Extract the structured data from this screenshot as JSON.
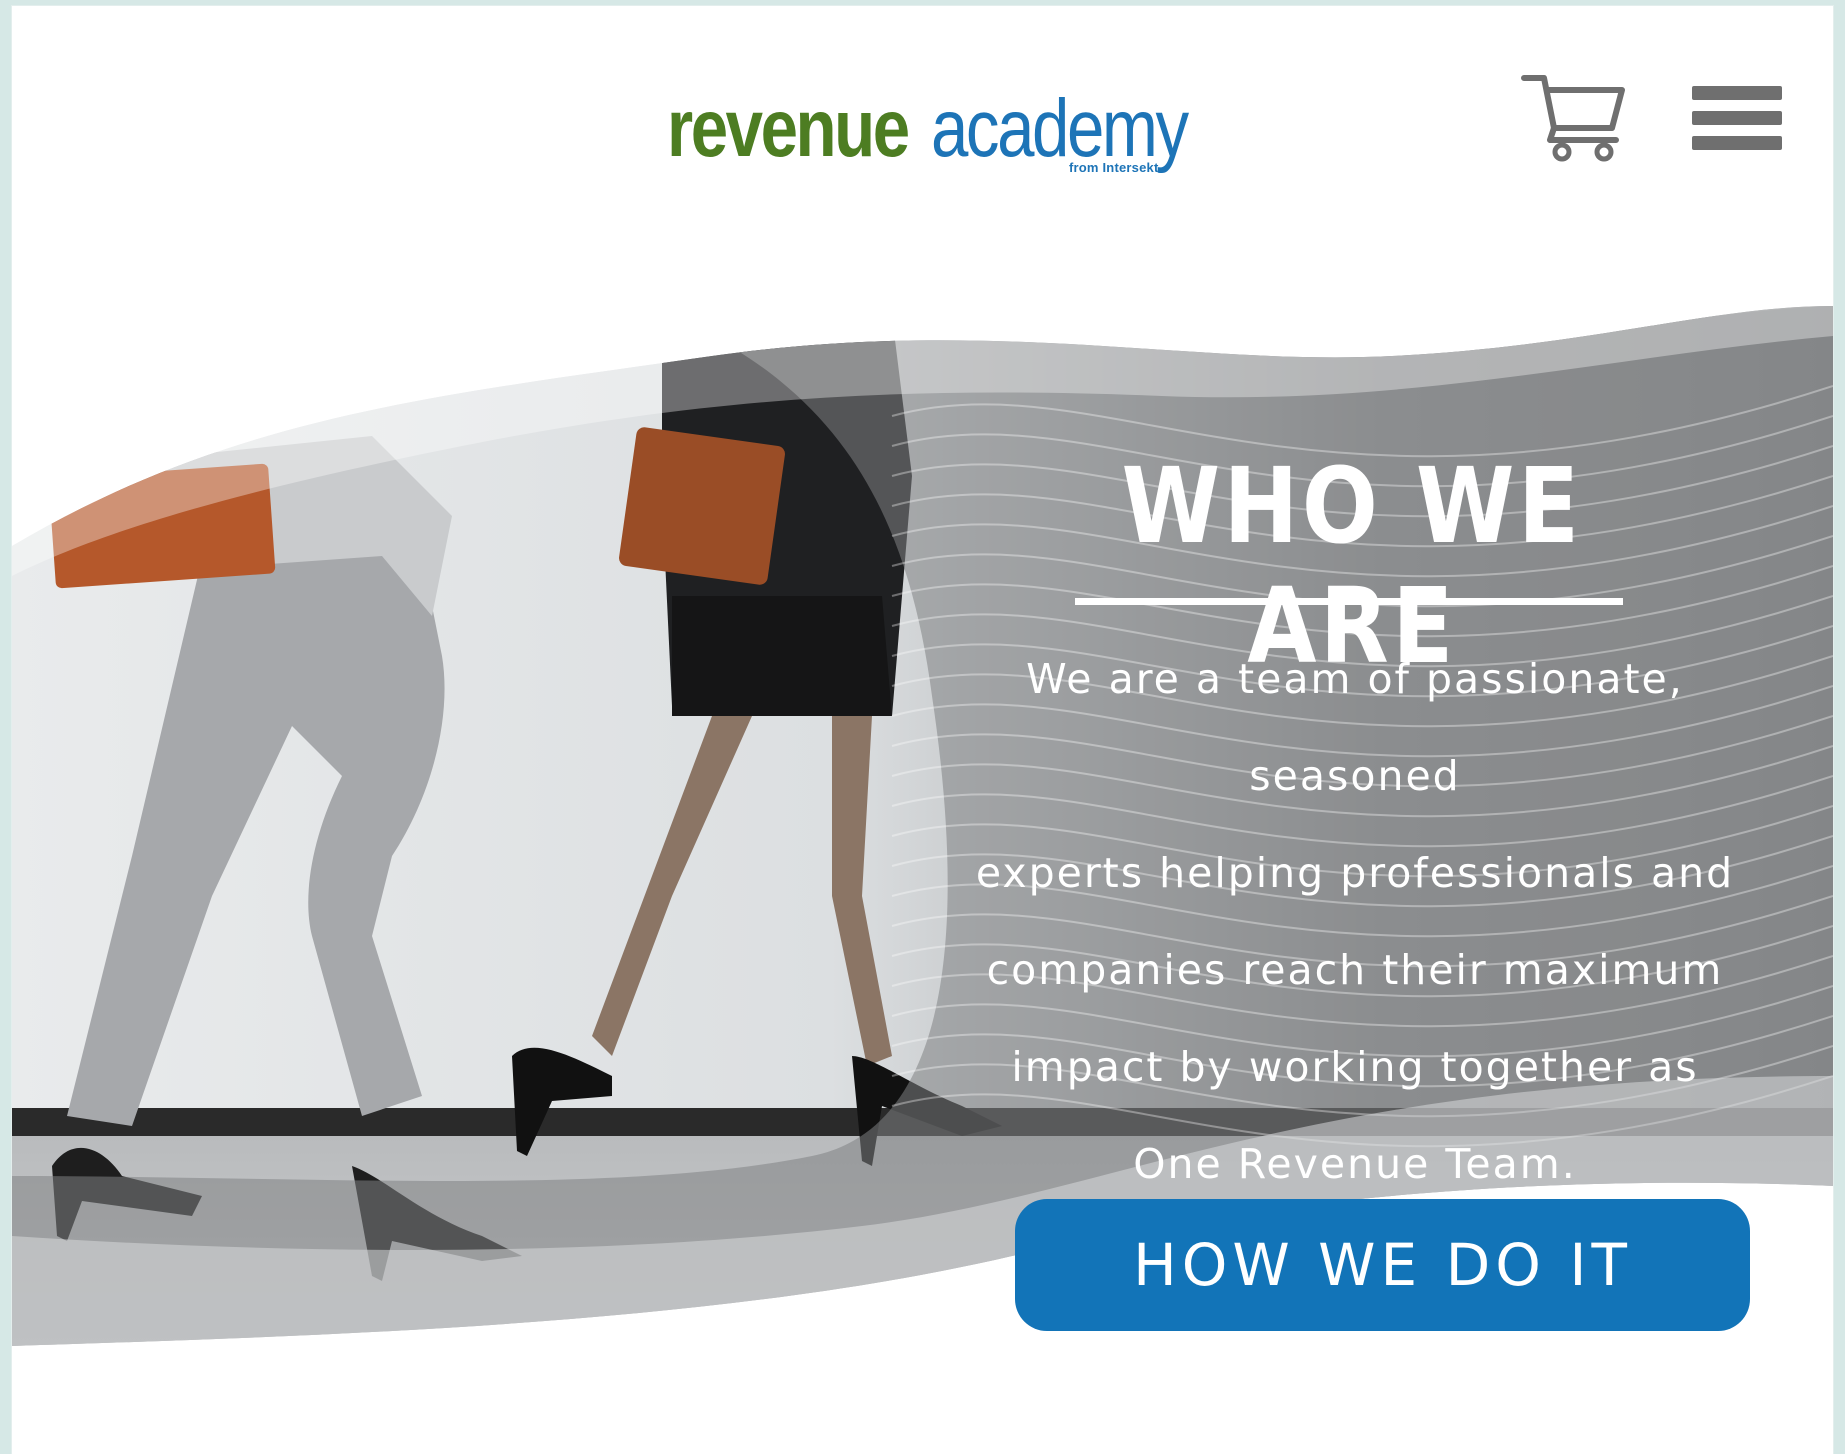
{
  "header": {
    "logo": {
      "brand_primary": "revenue",
      "brand_secondary": "academy",
      "tagline": "from Intersekt"
    },
    "cart_icon": "shopping-cart-icon",
    "menu_icon": "hamburger-menu-icon"
  },
  "hero": {
    "title": "WHO WE ARE",
    "description_lines": [
      "We are a team of passionate, seasoned",
      "experts helping professionals and",
      "companies reach their maximum",
      "impact by working together as",
      "One Revenue Team."
    ],
    "cta_label": "HOW WE DO IT"
  },
  "colors": {
    "brand_green": "#4d7d22",
    "brand_blue": "#1d74b7",
    "cta_blue": "#1274b8",
    "icon_gray": "#6f6f6f"
  }
}
